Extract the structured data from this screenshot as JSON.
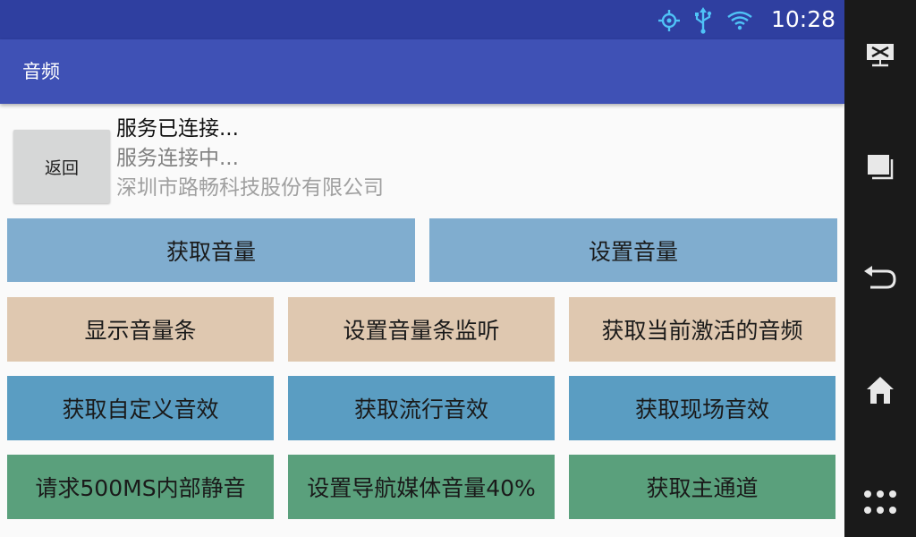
{
  "status_bar": {
    "time": "10:28",
    "icons": [
      "gps-icon",
      "usb-icon",
      "wifi-icon"
    ],
    "color": "#2f3fa0"
  },
  "app_bar": {
    "title": "音频",
    "color": "#3f51b5"
  },
  "back_button": {
    "label": "返回"
  },
  "status_lines": {
    "line1": "服务已连接...",
    "line2": "服务连接中...",
    "line3": "深圳市路畅科技股份有限公司"
  },
  "buttons": {
    "get_volume": "获取音量",
    "set_volume": "设置音量",
    "show_volume_bar": "显示音量条",
    "set_volume_bar_listener": "设置音量条监听",
    "get_active_audio": "获取当前激活的音频",
    "get_custom_effect": "获取自定义音效",
    "get_pop_effect": "获取流行音效",
    "get_live_effect": "获取现场音效",
    "request_mute": "请求500MS内部静音",
    "set_nav_media_volume": "设置导航媒体音量40%",
    "get_main_channel": "获取主通道"
  },
  "colors": {
    "row1": "#80adcf",
    "row2": "#dfc8b0",
    "row3": "#5a9dc2",
    "row4": "#5aa07c"
  },
  "nav_bar": {
    "icons": [
      "screenshot-icon",
      "recent-apps-icon",
      "back-icon",
      "home-icon",
      "app-drawer-icon"
    ]
  }
}
